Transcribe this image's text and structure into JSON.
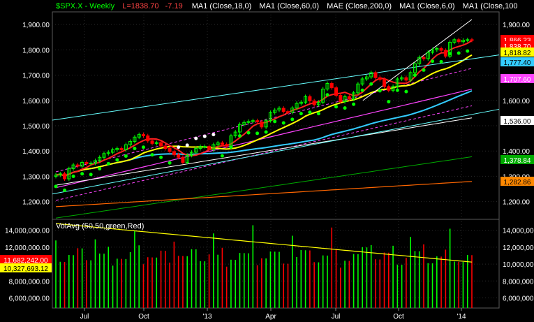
{
  "header": {
    "symbol": "$SPX.X - Weekly",
    "last": "L=1838.70",
    "change": "-7.19",
    "studies": [
      "MA1 (Close,18,0)",
      "MA1 (Close,60,0)",
      "MAE (Close,200,0)",
      "MA1 (Close,6,0)",
      "MA1 (Close,100"
    ]
  },
  "colors": {
    "background": "#000000",
    "up_candle": "#00ff00",
    "down_candle": "#ff0000",
    "ma6": "#ff2020",
    "ma18": "#ffff00",
    "ma60": "#33ccff",
    "mae200": "#ff44ff",
    "ma100": "#00aa00",
    "orange_line": "#ff6600",
    "channel": "#66ffff",
    "psar_up": "#00ff00",
    "psar_down": "#ffffff",
    "vol_avg": "#ffff00"
  },
  "volume_panel": {
    "label": "VolAvg (50,50,green,Red)"
  },
  "chart_data": [
    {
      "type": "candlestick",
      "title": "$SPX.X - Weekly",
      "x_ticks": [
        "Jul",
        "Oct",
        "'13",
        "Apr",
        "Jul",
        "Oct",
        "'14"
      ],
      "y_ticks": [
        "1,900.00",
        "1,800.00",
        "1,700.00",
        "1,600.00",
        "1,500.00",
        "1,400.00",
        "1,300.00",
        "1,200.00"
      ],
      "right_ticks": [
        "1,900.00",
        "1,800.00",
        "1,600.00",
        "1,400.00",
        "1,300.00",
        "1,200.00"
      ],
      "ylim": [
        1130,
        1950
      ],
      "grid": true,
      "close": [
        1305,
        1310,
        1290,
        1330,
        1345,
        1340,
        1355,
        1350,
        1352,
        1362,
        1375,
        1390,
        1395,
        1405,
        1410,
        1405,
        1425,
        1438,
        1455,
        1465,
        1460,
        1440,
        1430,
        1433,
        1420,
        1410,
        1398,
        1385,
        1375,
        1355,
        1383,
        1395,
        1410,
        1418,
        1418,
        1405,
        1425,
        1432,
        1426,
        1420,
        1460,
        1475,
        1505,
        1513,
        1517,
        1520,
        1515,
        1495,
        1520,
        1552,
        1562,
        1569,
        1556,
        1553,
        1570,
        1588,
        1593,
        1615,
        1598,
        1583,
        1593,
        1645,
        1667,
        1650,
        1620,
        1595,
        1615,
        1605,
        1630,
        1665,
        1685,
        1693,
        1710,
        1690,
        1683,
        1655,
        1640,
        1655,
        1685,
        1690,
        1680,
        1710,
        1745,
        1770,
        1765,
        1790,
        1800,
        1805,
        1798,
        1775,
        1830,
        1840,
        1832,
        1838,
        1840,
        1838
      ],
      "tags": [
        {
          "label": "1,866.23",
          "color": "#ff0000"
        },
        {
          "label": "1,838.70",
          "color": "#ff0000"
        },
        {
          "label": "1,818.82",
          "color": "#ffff00"
        },
        {
          "label": "1,777.40",
          "color": "#33ccff"
        },
        {
          "label": "1,707.60",
          "color": "#ff44ff"
        },
        {
          "label": "1,536.00",
          "color": "#ffffff"
        },
        {
          "label": "1,378.84",
          "color": "#00aa00"
        },
        {
          "label": "1,282.86",
          "color": "#ff8800"
        }
      ]
    },
    {
      "type": "bar",
      "title": "VolAvg (50,50,green,Red)",
      "y_ticks": [
        "14,000,000.00",
        "12,000,000.00",
        "10,000,000.00",
        "8,000,000.00",
        "6,000,000.00"
      ],
      "right_ticks": [
        "14,000,000",
        "12,000,000",
        "10,000,000",
        "8,000,000",
        "6,000,000"
      ],
      "ylim": [
        4800000,
        15300000
      ],
      "tags": [
        {
          "label": "11,682,242.00",
          "color": "#ff0000"
        },
        {
          "label": "10,327,693.12",
          "color": "#ffff00"
        }
      ]
    }
  ]
}
